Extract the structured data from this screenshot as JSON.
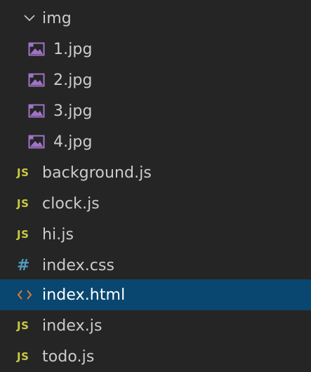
{
  "explorer": {
    "folder": {
      "name": "img",
      "expanded": true,
      "icon": "chevron-down-icon"
    },
    "folder_files": [
      {
        "name": "1.jpg",
        "icon": "image-file-icon"
      },
      {
        "name": "2.jpg",
        "icon": "image-file-icon"
      },
      {
        "name": "3.jpg",
        "icon": "image-file-icon"
      },
      {
        "name": "4.jpg",
        "icon": "image-file-icon"
      }
    ],
    "files": [
      {
        "name": "background.js",
        "icon": "js-file-icon",
        "badge": "JS"
      },
      {
        "name": "clock.js",
        "icon": "js-file-icon",
        "badge": "JS"
      },
      {
        "name": "hi.js",
        "icon": "js-file-icon",
        "badge": "JS"
      },
      {
        "name": "index.css",
        "icon": "css-file-icon",
        "badge": "#"
      },
      {
        "name": "index.html",
        "icon": "html-file-icon",
        "badge": "<>",
        "selected": true
      },
      {
        "name": "index.js",
        "icon": "js-file-icon",
        "badge": "JS"
      },
      {
        "name": "todo.js",
        "icon": "js-file-icon",
        "badge": "JS"
      }
    ]
  },
  "colors": {
    "background": "#252526",
    "selected_background": "#094771",
    "text": "#cccccc",
    "js_icon": "#cbcb41",
    "css_icon": "#519aba",
    "html_icon": "#e37933",
    "image_icon": "#a074c4"
  }
}
